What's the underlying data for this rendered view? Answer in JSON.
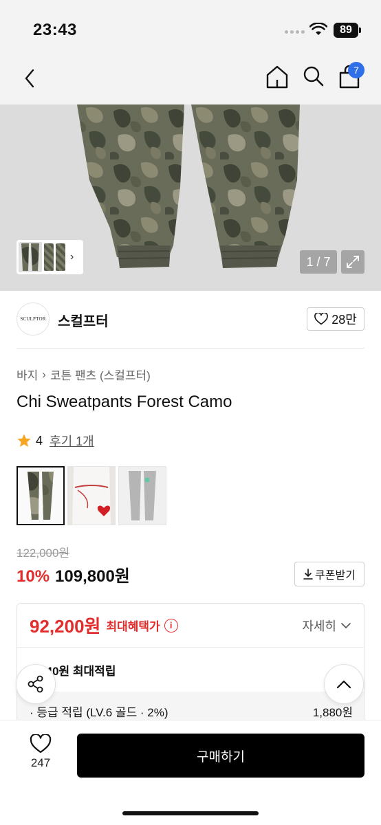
{
  "status_bar": {
    "time": "23:43",
    "battery": "89"
  },
  "nav": {
    "cart_count": "7"
  },
  "gallery": {
    "page_indicator": "1 / 7"
  },
  "brand": {
    "logo_text": "SCULPTOR",
    "name": "스컬프터",
    "likes": "28만"
  },
  "product": {
    "breadcrumb": [
      "바지",
      "코튼 팬츠 (스컬프터)"
    ],
    "title": "Chi Sweatpants Forest Camo",
    "rating": "4",
    "reviews": "후기 1개",
    "original_price": "122,000원",
    "discount": "10%",
    "sale_price": "109,800원",
    "coupon_label": "쿠폰받기"
  },
  "benefit": {
    "best_price": "92,200원",
    "best_price_label": "최대혜택가",
    "detail_label": "자세히",
    "points_label": "5,140원 최대적립",
    "grade_label": "· 등급 적립 (LV.6 골드 · 2%)",
    "grade_value": "1,880원"
  },
  "bottom_bar": {
    "wish_count": "247",
    "buy_label": "구매하기"
  },
  "colors": {
    "accent_red": "#e32d2d",
    "badge_blue": "#2f6fe8",
    "buy_black": "#000000"
  }
}
